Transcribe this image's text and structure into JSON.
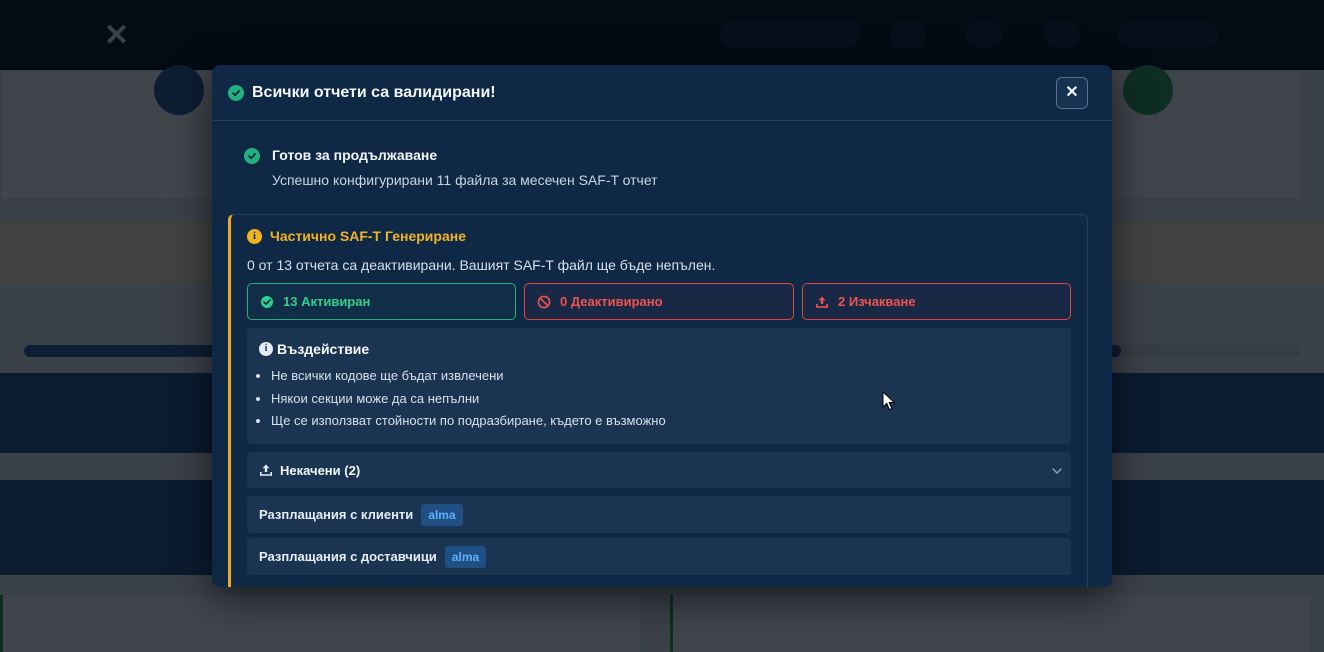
{
  "modal": {
    "title": "Всички отчети са валидирани!",
    "close_label": "✕",
    "ready": {
      "title": "Готов за продължаване",
      "subtitle": "Успешно конфигурирани 11 файла за месечен SAF-T отчет"
    },
    "partial": {
      "title": "Частично SAF-T Генериране",
      "subtitle": "0 от 13 отчета са деактивирани. Вашият SAF-T файл ще бъде непълен.",
      "status": {
        "activated": "13 Активиран",
        "deactivated": "0 Деактивирано",
        "pending": "2 Изчакване"
      },
      "impact": {
        "title": "Въздействие",
        "items": [
          "Не всички кодове ще бъдат извлечени",
          "Някои секции може да са непълни",
          "Ще се използват стойности по подразбиране, където е възможно"
        ]
      },
      "not_uploaded": {
        "title": "Некачени (2)",
        "items": [
          {
            "label": "Разплащания с клиенти",
            "tag": "alma"
          },
          {
            "label": "Разплащания с доставчици",
            "tag": "alma"
          }
        ]
      }
    }
  },
  "colors": {
    "success": "#22b07d",
    "warning": "#f0b41f",
    "danger": "#e0443e",
    "modal_bg": "#0f2845",
    "panel_bg": "#1a3452"
  },
  "icons": {
    "title": "check-circle-icon",
    "close": "close-icon",
    "ready": "check-circle-icon",
    "partial": "info-icon",
    "activated": "check-circle-icon",
    "deactivated": "ban-icon",
    "pending": "upload-icon",
    "impact": "info-icon",
    "not_uploaded": "upload-icon",
    "accordion": "chevron-down-icon"
  }
}
